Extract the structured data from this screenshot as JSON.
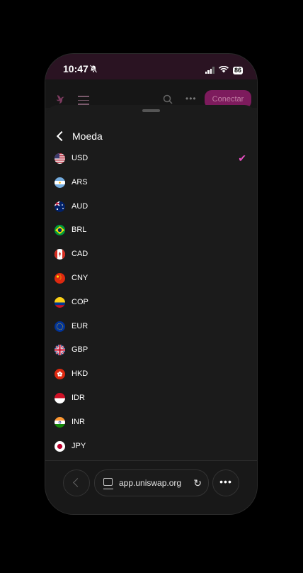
{
  "status_bar": {
    "time": "10:47",
    "battery": "86",
    "icons": [
      "bell-slash-icon",
      "signal-icon",
      "wifi-icon",
      "battery-icon"
    ]
  },
  "app_bar": {
    "connect_label": "Conectar",
    "icons": [
      "uniswap-logo-icon",
      "menu-icon",
      "search-icon",
      "more-icon"
    ]
  },
  "sheet": {
    "title": "Moeda",
    "selected": "USD",
    "currencies": [
      {
        "code": "USD",
        "flag": "us-flag-icon"
      },
      {
        "code": "ARS",
        "flag": "ar-flag-icon"
      },
      {
        "code": "AUD",
        "flag": "au-flag-icon"
      },
      {
        "code": "BRL",
        "flag": "br-flag-icon"
      },
      {
        "code": "CAD",
        "flag": "ca-flag-icon"
      },
      {
        "code": "CNY",
        "flag": "cn-flag-icon"
      },
      {
        "code": "COP",
        "flag": "co-flag-icon"
      },
      {
        "code": "EUR",
        "flag": "eu-flag-icon"
      },
      {
        "code": "GBP",
        "flag": "gb-flag-icon"
      },
      {
        "code": "HKD",
        "flag": "hk-flag-icon"
      },
      {
        "code": "IDR",
        "flag": "id-flag-icon"
      },
      {
        "code": "INR",
        "flag": "in-flag-icon"
      },
      {
        "code": "JPY",
        "flag": "jp-flag-icon"
      }
    ]
  },
  "browser": {
    "url": "app.uniswap.org"
  },
  "colors": {
    "accent": "#e84fc2",
    "connect_bg": "#7d1b5d",
    "sheet_bg": "#1b1b1b"
  }
}
